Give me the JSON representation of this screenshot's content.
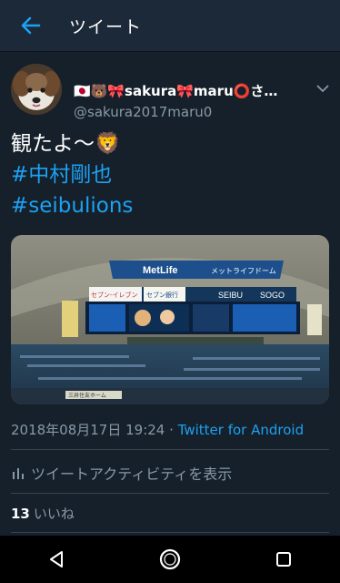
{
  "appbar": {
    "title": "ツイート"
  },
  "tweet": {
    "display_name": "🇯🇵🐻🎀sakura🎀maru⭕さ…",
    "handle": "@sakura2017maru0",
    "text_line": "観たよ～🦁",
    "hashtag1": "#中村剛也",
    "hashtag2": "#seibulions",
    "media": {
      "banner_logo": "MetLife",
      "banner_text": "メットライフドーム",
      "board_left": "セブン-イレブン",
      "board_mid": "セブン銀行",
      "board_seibu": "SEIBU",
      "board_sogo": "SOGO",
      "sign_text": "三井住友ホーム"
    },
    "timestamp": "2018年08月17日 19:24",
    "separator": " · ",
    "source": "Twitter for Android",
    "activity_label": "ツイートアクティビティを表示",
    "likes_count": "13",
    "likes_label": "いいね"
  },
  "colors": {
    "bg": "#15202b",
    "accent": "#1da1f2",
    "muted": "#8899a6"
  },
  "icons": [
    "back-arrow-icon",
    "chevron-down-icon",
    "bar-chart-icon",
    "triangle-back-icon",
    "circle-home-icon",
    "square-recents-icon"
  ]
}
